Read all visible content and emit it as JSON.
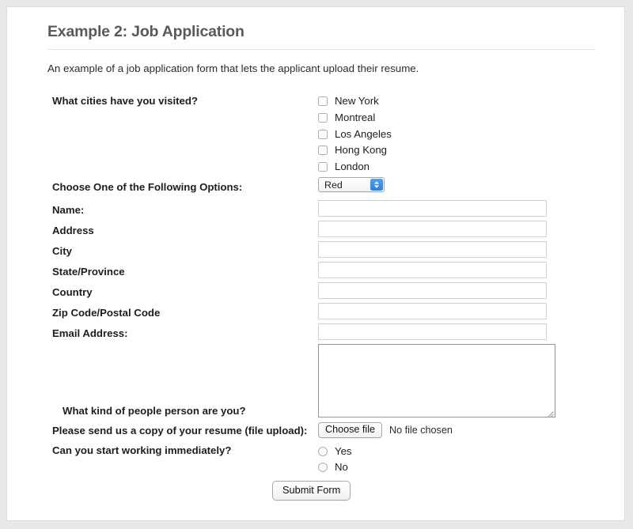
{
  "header": {
    "title": "Example 2: Job Application",
    "intro": "An example of a job application form that lets the applicant upload their resume."
  },
  "form": {
    "cities": {
      "label": "What cities have you visited?",
      "options": [
        {
          "label": "New York",
          "checked": false
        },
        {
          "label": "Montreal",
          "checked": false
        },
        {
          "label": "Los Angeles",
          "checked": false
        },
        {
          "label": "Hong Kong",
          "checked": false
        },
        {
          "label": "London",
          "checked": false
        }
      ]
    },
    "select": {
      "label": "Choose One of the Following Options:",
      "value": "Red",
      "icon": "chevron-up-down-icon",
      "accent_color": "#2b7de0"
    },
    "fields": [
      {
        "label": "Name:",
        "value": "",
        "placeholder": ""
      },
      {
        "label": "Address",
        "value": "",
        "placeholder": ""
      },
      {
        "label": "City",
        "value": "",
        "placeholder": ""
      },
      {
        "label": "State/Province",
        "value": "",
        "placeholder": ""
      },
      {
        "label": "Country",
        "value": "",
        "placeholder": ""
      },
      {
        "label": "Zip Code/Postal Code",
        "value": "",
        "placeholder": ""
      },
      {
        "label": "Email Address:",
        "value": "",
        "placeholder": ""
      }
    ],
    "people_person": {
      "label": "What kind of people person are you?",
      "value": "",
      "placeholder": ""
    },
    "resume": {
      "label": "Please send us a copy of your resume (file upload):",
      "button_label": "Choose file",
      "status": "No file chosen"
    },
    "start_immediately": {
      "label": "Can you start working immediately?",
      "options": [
        {
          "label": "Yes",
          "selected": false
        },
        {
          "label": "No",
          "selected": false
        }
      ]
    },
    "submit_label": "Submit Form"
  }
}
